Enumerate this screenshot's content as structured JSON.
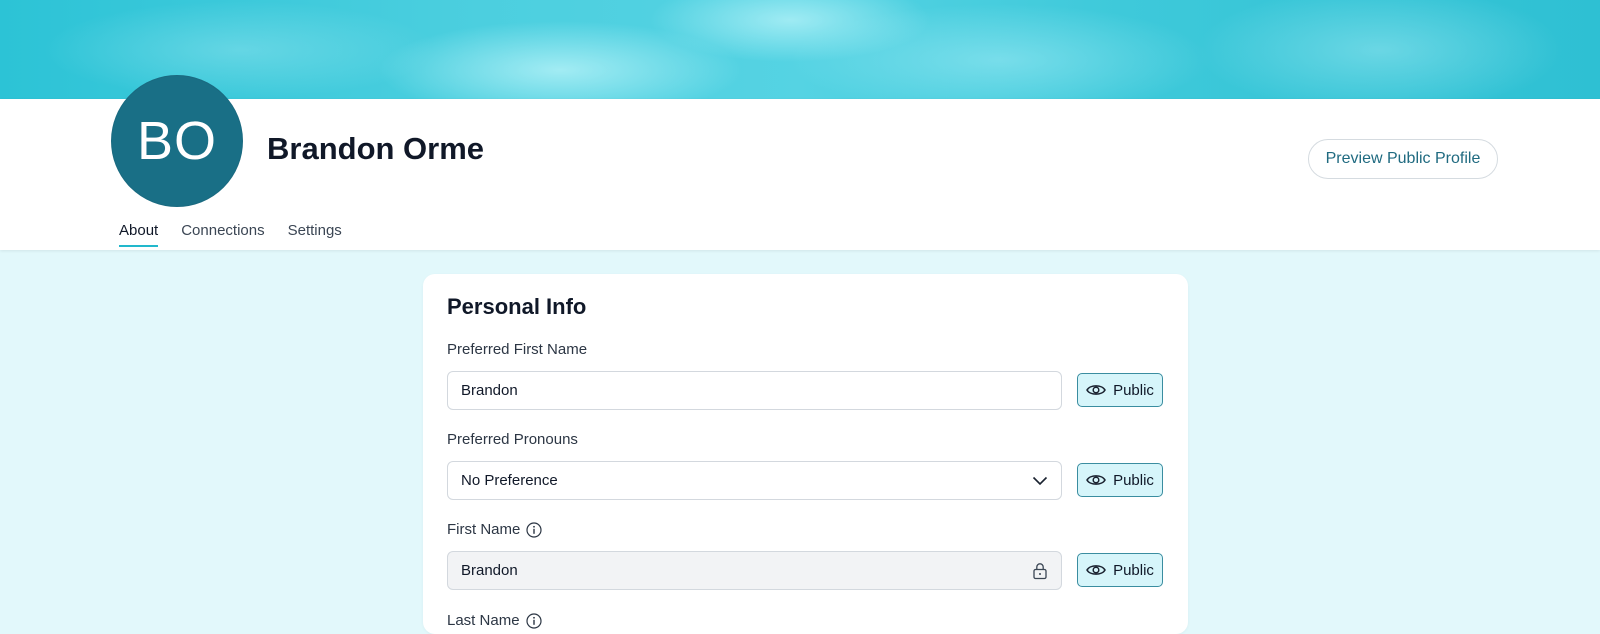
{
  "colors": {
    "banner": "#3ec9da",
    "avatar_bg": "#196f86",
    "accent": "#22b8cc",
    "page_bg": "#e2f8fb",
    "public_badge_bg": "#d6f5fa",
    "public_badge_border": "#3a8da0"
  },
  "profile": {
    "initials": "BO",
    "name": "Brandon Orme",
    "preview_label": "Preview Public Profile"
  },
  "tabs": [
    {
      "label": "About",
      "active": true
    },
    {
      "label": "Connections",
      "active": false
    },
    {
      "label": "Settings",
      "active": false
    }
  ],
  "personal_info": {
    "title": "Personal Info",
    "fields": {
      "preferred_first_name": {
        "label": "Preferred First Name",
        "value": "Brandon",
        "visibility": "Public"
      },
      "preferred_pronouns": {
        "label": "Preferred Pronouns",
        "value": "No Preference",
        "visibility": "Public"
      },
      "first_name": {
        "label": "First Name",
        "value": "Brandon",
        "visibility": "Public"
      },
      "last_name": {
        "label": "Last Name"
      }
    }
  },
  "icons": {
    "visibility": "eye-icon",
    "dropdown": "chevron-down-icon",
    "locked": "lock-icon",
    "info": "info-icon"
  }
}
